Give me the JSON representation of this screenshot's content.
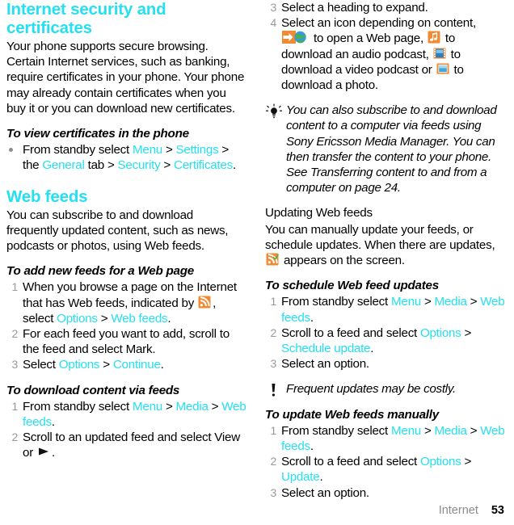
{
  "document": {
    "footer": {
      "chapter": "Internet",
      "page_number": "53"
    }
  },
  "left_column": {
    "section_title": "Internet security and certificates",
    "intro_paragraph": "Your phone supports secure browsing. Certain Internet services, such as banking, require certificates in your phone. Your phone may already contain certificates when you buy it or you can download new certificates.",
    "procedure_view_certificates": {
      "title": "To view certificates in the phone",
      "bullet": {
        "text_1": "From standby select ",
        "link_1": "Menu",
        "sep_1": " > ",
        "link_2": "Settings",
        "text_2": " > the ",
        "link_3": "General",
        "text_3": " tab > ",
        "link_4": "Security",
        "sep_2": " > ",
        "link_5": "Certificates",
        "text_4": "."
      }
    },
    "web_feeds_title": "Web feeds",
    "web_feeds_paragraph": "You can subscribe to and download frequently updated content, such as news, podcasts or photos, using Web feeds.",
    "procedure_add_feeds": {
      "title": "To add new feeds for a Web page",
      "step1": {
        "num": "1",
        "text_1": "When you browse a page on the Internet that has Web feeds, indicated by ",
        "icon": "rss-feed-icon",
        "text_2": ", select ",
        "link_1": "Options",
        "sep_1": " > ",
        "link_2": "Web feeds",
        "text_3": "."
      },
      "step2": {
        "num": "2",
        "text": "For each feed you want to add, scroll to the feed and select Mark."
      },
      "step3": {
        "num": "3",
        "text_1": "Select ",
        "link_1": "Options",
        "sep_1": " > ",
        "link_2": "Continue",
        "text_2": "."
      }
    },
    "procedure_download_content": {
      "title": "To download content via feeds",
      "step1": {
        "num": "1",
        "text_1": "From standby select ",
        "link_1": "Menu",
        "sep_1": " > ",
        "link_2": "Media",
        "sep_2": " > ",
        "link_3": "Web feeds",
        "text_2": "."
      },
      "step2": {
        "num": "2",
        "text_1": "Scroll to an updated feed and select View or ",
        "icon": "play-triangle-icon",
        "text_2": "."
      }
    }
  },
  "right_column": {
    "procedure_download_content_cont": {
      "step3": {
        "num": "3",
        "text": "Select a heading to expand."
      },
      "step4": {
        "num": "4",
        "text_1": "Select an icon depending on content, ",
        "icon_1": "web-page-globe-icon",
        "text_2": " to open a Web page, ",
        "icon_2": "audio-podcast-music-note-icon",
        "text_3": " to download an audio podcast, ",
        "icon_3": "video-podcast-film-icon",
        "text_4": " to download a video podcast or ",
        "icon_4": "photo-image-icon",
        "text_5": " to download a photo."
      }
    },
    "tip_note": {
      "icon": "lightbulb-tip-icon",
      "text": "You can also subscribe to and download content to a computer via feeds using Sony Ericsson Media Manager. You can then transfer the content to your phone. See Transferring content to and from a computer on page 24."
    },
    "updating_title": "Updating Web feeds",
    "updating_paragraph": {
      "text_1": "You can manually update your feeds, or schedule updates. When there are updates, ",
      "icon": "rss-feed-updated-icon",
      "text_2": " appears on the screen."
    },
    "procedure_schedule_updates": {
      "title": "To schedule Web feed updates",
      "step1": {
        "num": "1",
        "text_1": "From standby select ",
        "link_1": "Menu",
        "sep_1": " > ",
        "link_2": "Media",
        "sep_2": " > ",
        "link_3": "Web feeds",
        "text_2": "."
      },
      "step2": {
        "num": "2",
        "text_1": "Scroll to a feed and select ",
        "link_1": "Options",
        "sep_1": " > ",
        "link_2": "Schedule update",
        "text_2": "."
      },
      "step3": {
        "num": "3",
        "text": "Select an option."
      }
    },
    "warning_note": {
      "icon": "exclamation-note-icon",
      "text": "Frequent updates may be costly."
    },
    "procedure_update_manually": {
      "title": "To update Web feeds manually",
      "step1": {
        "num": "1",
        "text_1": "From standby select ",
        "link_1": "Menu",
        "sep_1": " > ",
        "link_2": "Media",
        "sep_2": " > ",
        "link_3": "Web feeds",
        "text_2": "."
      },
      "step2": {
        "num": "2",
        "text_1": "Scroll to a feed and select ",
        "link_1": "Options",
        "sep_1": " > ",
        "link_2": "Update",
        "text_2": "."
      },
      "step3": {
        "num": "3",
        "text": "Select an option."
      }
    }
  },
  "colors": {
    "link_cyan": "#25e0f0",
    "rss_orange": "#f08a33",
    "step_number_gray": "#9a9a9a",
    "footer_gray": "#8c8c8c"
  }
}
